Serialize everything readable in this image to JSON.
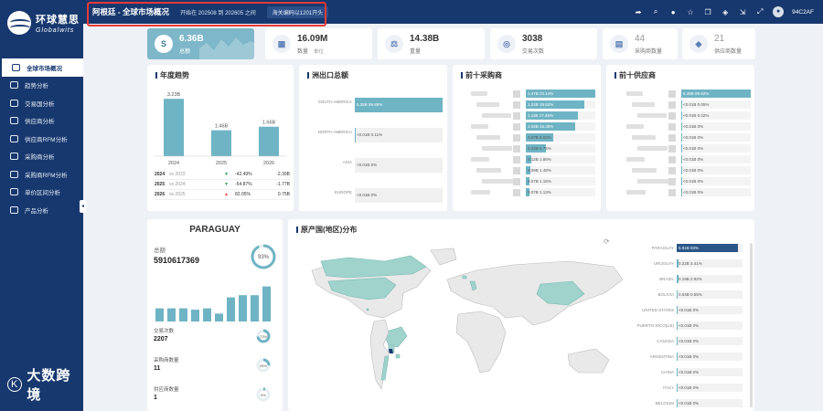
{
  "app": {
    "logo_cn": "环球慧思",
    "logo_en": "Globalwits",
    "brand_footer": "大数跨境",
    "brand_footer_mark": "K"
  },
  "sidebar": {
    "items": [
      {
        "label": "全球市场概况",
        "active": true
      },
      {
        "label": "趋势分析"
      },
      {
        "label": "交易国分析"
      },
      {
        "label": "供应商分析"
      },
      {
        "label": "供应商RFM分析"
      },
      {
        "label": "采购商分析"
      },
      {
        "label": "采购商RFM分析"
      },
      {
        "label": "单价区间分析"
      },
      {
        "label": "产品分析"
      }
    ],
    "collapse_glyph": "◂"
  },
  "topbar": {
    "company": "阿根廷 - 全球市场概况",
    "date_range": "开始在 202508 到 202605 之间",
    "hs_code": "海关编码以1201开头",
    "user_id": "94C2AF",
    "tools": [
      "share-icon",
      "search-icon",
      "info-icon",
      "star-icon",
      "copy-icon",
      "tag-icon",
      "export-icon",
      "fullscreen-icon"
    ],
    "tool_glyphs": [
      "➦",
      "⌕",
      "●",
      "☆",
      "❐",
      "◈",
      "⇲",
      "⤢"
    ]
  },
  "kpis": [
    {
      "value": "6.36B",
      "label": "总额",
      "icon": "S"
    },
    {
      "value": "16.09M",
      "label": "数量",
      "unit_label": "单位",
      "icon": "▦"
    },
    {
      "value": "14.38B",
      "label": "重量",
      "icon": "⚖"
    },
    {
      "value": "3038",
      "label": "交易次数",
      "icon": "◎"
    },
    {
      "value": "44",
      "label": "采购商数量",
      "icon": "▤"
    },
    {
      "value": "21",
      "label": "供应商数量",
      "icon": "◆"
    }
  ],
  "yearly": {
    "title": "年度趋势",
    "bars": [
      {
        "year": "2024",
        "label": "3.23B",
        "value": 3.23
      },
      {
        "year": "2025",
        "label": "1.46B",
        "value": 1.46
      },
      {
        "year": "2026",
        "label": "1.66B",
        "value": 1.66
      }
    ],
    "rows": [
      {
        "year": "2024",
        "vs": "vs 2023",
        "pct": "-42.49%",
        "delta": "-2.39B",
        "dir": "down"
      },
      {
        "year": "2025",
        "vs": "vs 2024",
        "pct": "-54.87%",
        "delta": "-1.77B",
        "dir": "down"
      },
      {
        "year": "2026",
        "vs": "vs 2025",
        "pct": "82.05%",
        "delta": "0.75B",
        "dir": "up"
      }
    ]
  },
  "continents": {
    "title": "洲出口总额",
    "rows": [
      {
        "name": "SOUTH AMERICA",
        "value": "6.35B",
        "pct": "99.89%",
        "share": 0.9989
      },
      {
        "name": "NORTH AMERICA",
        "value": "<0.01B",
        "pct": "0.11%",
        "share": 0.0011
      },
      {
        "name": "ASIA",
        "value": "<0.01B",
        "pct": "0%",
        "share": 0
      },
      {
        "name": "EUROPE",
        "value": "<0.01B",
        "pct": "0%",
        "share": 0
      }
    ]
  },
  "top_buyers": {
    "title": "前十采购商",
    "rows": [
      {
        "value": "1.47B",
        "pct": "23.14%",
        "share": 0.2314
      },
      {
        "value": "1.24B",
        "pct": "19.52%",
        "share": 0.1952
      },
      {
        "value": "1.11B",
        "pct": "17.46%",
        "share": 0.1746
      },
      {
        "value": "1.04B",
        "pct": "16.39%",
        "share": 0.1639
      },
      {
        "value": "0.57B",
        "pct": "9.02%",
        "share": 0.0902
      },
      {
        "value": "0.43B",
        "pct": "6.74%",
        "share": 0.0674
      },
      {
        "value": "0.12B",
        "pct": "1.86%",
        "share": 0.0186
      },
      {
        "value": "0.09B",
        "pct": "1.48%",
        "share": 0.0148
      },
      {
        "value": "0.07B",
        "pct": "1.16%",
        "share": 0.0116
      },
      {
        "value": "0.07B",
        "pct": "1.13%",
        "share": 0.0113
      }
    ]
  },
  "top_suppliers": {
    "title": "前十供应商",
    "rows": [
      {
        "value": "6.35B",
        "pct": "99.92%",
        "share": 0.9992
      },
      {
        "value": "<0.01B",
        "pct": "0.05%",
        "share": 0.0005
      },
      {
        "value": "<0.01B",
        "pct": "0.02%",
        "share": 0.0002
      },
      {
        "value": "<0.01B",
        "pct": "0%",
        "share": 0
      },
      {
        "value": "<0.01B",
        "pct": "0%",
        "share": 0
      },
      {
        "value": "<0.01B",
        "pct": "0%",
        "share": 0
      },
      {
        "value": "<0.01B",
        "pct": "0%",
        "share": 0
      },
      {
        "value": "<0.01B",
        "pct": "0%",
        "share": 0
      },
      {
        "value": "<0.01B",
        "pct": "0%",
        "share": 0
      },
      {
        "value": "<0.01B",
        "pct": "0%",
        "share": 0
      }
    ]
  },
  "country_card": {
    "title": "PARAGUAY",
    "total_label": "总额",
    "total_value": "5910617369",
    "gauge_pct": "93%",
    "gauge_value": 0.93,
    "bars": [
      0.3,
      0.3,
      0.3,
      0.27,
      0.3,
      0.18,
      0.55,
      0.6,
      0.6,
      0.8
    ],
    "stats": [
      {
        "label": "交易次数",
        "value": "2207",
        "pct": "73%",
        "gauge_value": 0.73
      },
      {
        "label": "采购商数量",
        "value": "11",
        "pct": "25%",
        "gauge_value": 0.25
      },
      {
        "label": "供应商数量",
        "value": "1",
        "pct": "5%",
        "gauge_value": 0.05
      }
    ]
  },
  "origin_map": {
    "title": "原产国(地区)分布",
    "rows": [
      {
        "name": "PARAGUAY",
        "value": "5.91B",
        "pct": "93%",
        "share": 0.93,
        "highlight": true
      },
      {
        "name": "URUGUAY",
        "value": "0.22B",
        "pct": "3.41%",
        "share": 0.0341
      },
      {
        "name": "BRAZIL",
        "value": "0.19B",
        "pct": "2.92%",
        "share": 0.0292
      },
      {
        "name": "BOLIVIA",
        "value": "0.04B",
        "pct": "0.55%",
        "share": 0.0055
      },
      {
        "name": "UNITED STATES",
        "value": "<0.01B",
        "pct": "0%",
        "share": 0
      },
      {
        "name": "PUERTO RICO(US)",
        "value": "<0.01B",
        "pct": "0%",
        "share": 0
      },
      {
        "name": "CANADA",
        "value": "<0.01B",
        "pct": "0%",
        "share": 0
      },
      {
        "name": "ARGENTINA",
        "value": "<0.01B",
        "pct": "0%",
        "share": 0
      },
      {
        "name": "CHINA",
        "value": "<0.01B",
        "pct": "0%",
        "share": 0
      },
      {
        "name": "ITALY",
        "value": "<0.01B",
        "pct": "0%",
        "share": 0
      },
      {
        "name": "BELGIUM",
        "value": "<0.01B",
        "pct": "0%",
        "share": 0
      }
    ]
  },
  "colors": {
    "navy": "#17386e",
    "teal": "#6fb4c4",
    "highlight_bar": "#2b5687",
    "red": "#e53935",
    "green": "#2e9e5b"
  }
}
